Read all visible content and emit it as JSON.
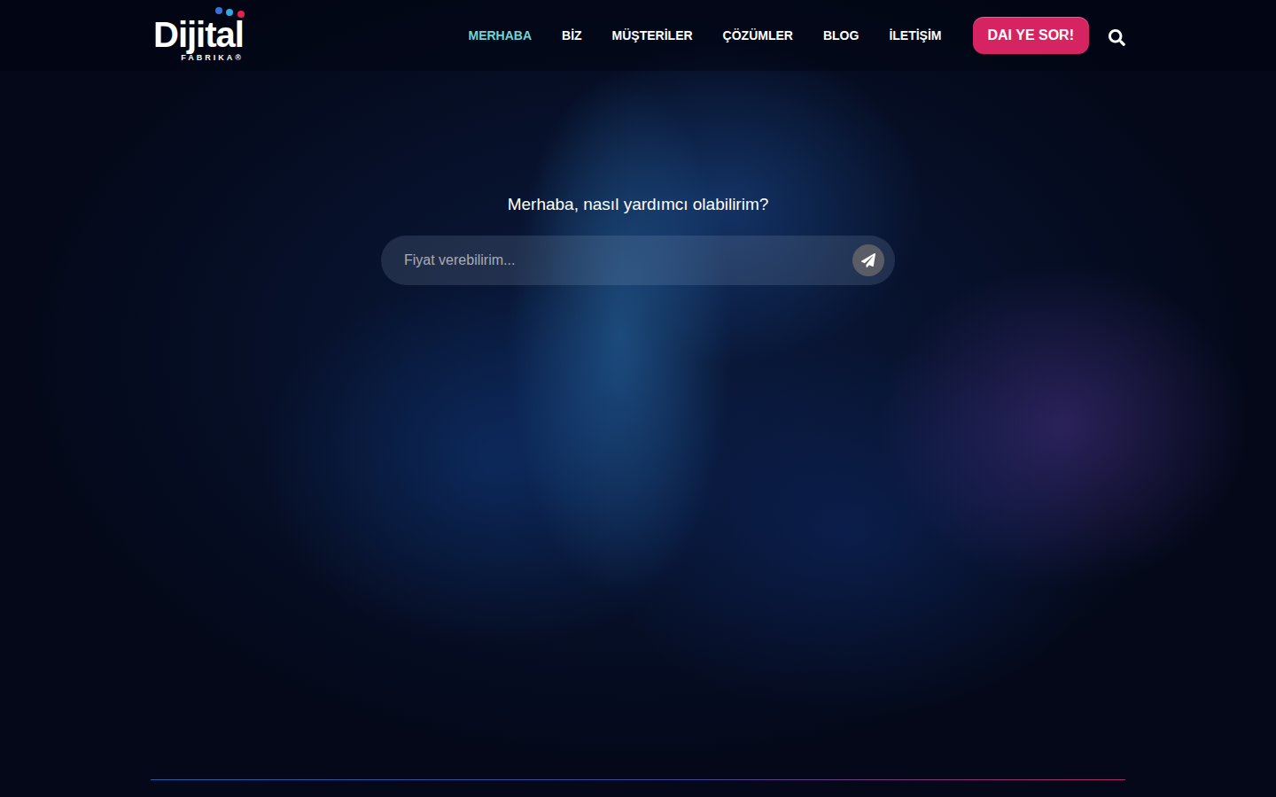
{
  "logo": {
    "title": "Dijital",
    "subtitle": "FABRIKA",
    "mark": "®"
  },
  "nav": {
    "items": [
      {
        "label": "MERHABA",
        "selected": true
      },
      {
        "label": "BİZ",
        "selected": false
      },
      {
        "label": "MÜŞTERİLER",
        "selected": false
      },
      {
        "label": "ÇÖZÜMLER",
        "selected": false
      },
      {
        "label": "BLOG",
        "selected": false
      },
      {
        "label": "İLETİŞİM",
        "selected": false
      }
    ]
  },
  "cta": {
    "label": "DAI YE SOR!"
  },
  "hero": {
    "title": "Merhaba, nasıl yardımcı olabilirim?",
    "input": {
      "placeholder": "Fiyat verebilirim..."
    }
  }
}
